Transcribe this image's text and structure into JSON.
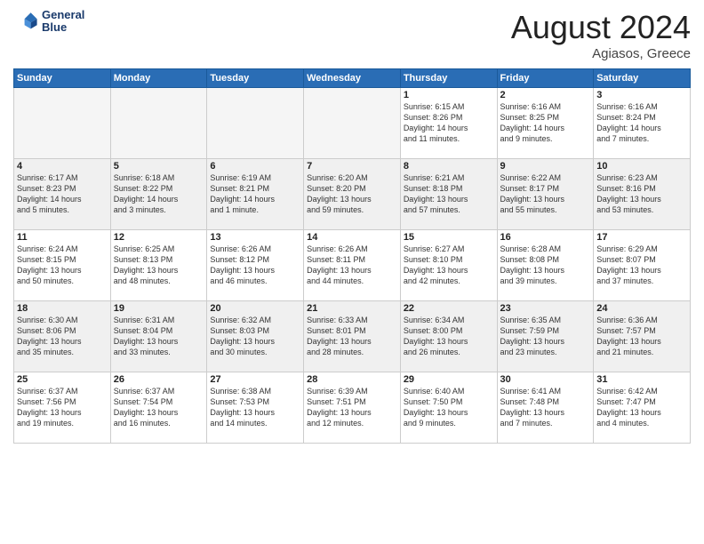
{
  "header": {
    "logo_line1": "General",
    "logo_line2": "Blue",
    "month": "August 2024",
    "location": "Agiasos, Greece"
  },
  "weekdays": [
    "Sunday",
    "Monday",
    "Tuesday",
    "Wednesday",
    "Thursday",
    "Friday",
    "Saturday"
  ],
  "weeks": [
    [
      {
        "day": "",
        "info": "",
        "empty": true
      },
      {
        "day": "",
        "info": "",
        "empty": true
      },
      {
        "day": "",
        "info": "",
        "empty": true
      },
      {
        "day": "",
        "info": "",
        "empty": true
      },
      {
        "day": "1",
        "info": "Sunrise: 6:15 AM\nSunset: 8:26 PM\nDaylight: 14 hours\nand 11 minutes."
      },
      {
        "day": "2",
        "info": "Sunrise: 6:16 AM\nSunset: 8:25 PM\nDaylight: 14 hours\nand 9 minutes."
      },
      {
        "day": "3",
        "info": "Sunrise: 6:16 AM\nSunset: 8:24 PM\nDaylight: 14 hours\nand 7 minutes."
      }
    ],
    [
      {
        "day": "4",
        "info": "Sunrise: 6:17 AM\nSunset: 8:23 PM\nDaylight: 14 hours\nand 5 minutes."
      },
      {
        "day": "5",
        "info": "Sunrise: 6:18 AM\nSunset: 8:22 PM\nDaylight: 14 hours\nand 3 minutes."
      },
      {
        "day": "6",
        "info": "Sunrise: 6:19 AM\nSunset: 8:21 PM\nDaylight: 14 hours\nand 1 minute."
      },
      {
        "day": "7",
        "info": "Sunrise: 6:20 AM\nSunset: 8:20 PM\nDaylight: 13 hours\nand 59 minutes."
      },
      {
        "day": "8",
        "info": "Sunrise: 6:21 AM\nSunset: 8:18 PM\nDaylight: 13 hours\nand 57 minutes."
      },
      {
        "day": "9",
        "info": "Sunrise: 6:22 AM\nSunset: 8:17 PM\nDaylight: 13 hours\nand 55 minutes."
      },
      {
        "day": "10",
        "info": "Sunrise: 6:23 AM\nSunset: 8:16 PM\nDaylight: 13 hours\nand 53 minutes."
      }
    ],
    [
      {
        "day": "11",
        "info": "Sunrise: 6:24 AM\nSunset: 8:15 PM\nDaylight: 13 hours\nand 50 minutes."
      },
      {
        "day": "12",
        "info": "Sunrise: 6:25 AM\nSunset: 8:13 PM\nDaylight: 13 hours\nand 48 minutes."
      },
      {
        "day": "13",
        "info": "Sunrise: 6:26 AM\nSunset: 8:12 PM\nDaylight: 13 hours\nand 46 minutes."
      },
      {
        "day": "14",
        "info": "Sunrise: 6:26 AM\nSunset: 8:11 PM\nDaylight: 13 hours\nand 44 minutes."
      },
      {
        "day": "15",
        "info": "Sunrise: 6:27 AM\nSunset: 8:10 PM\nDaylight: 13 hours\nand 42 minutes."
      },
      {
        "day": "16",
        "info": "Sunrise: 6:28 AM\nSunset: 8:08 PM\nDaylight: 13 hours\nand 39 minutes."
      },
      {
        "day": "17",
        "info": "Sunrise: 6:29 AM\nSunset: 8:07 PM\nDaylight: 13 hours\nand 37 minutes."
      }
    ],
    [
      {
        "day": "18",
        "info": "Sunrise: 6:30 AM\nSunset: 8:06 PM\nDaylight: 13 hours\nand 35 minutes."
      },
      {
        "day": "19",
        "info": "Sunrise: 6:31 AM\nSunset: 8:04 PM\nDaylight: 13 hours\nand 33 minutes."
      },
      {
        "day": "20",
        "info": "Sunrise: 6:32 AM\nSunset: 8:03 PM\nDaylight: 13 hours\nand 30 minutes."
      },
      {
        "day": "21",
        "info": "Sunrise: 6:33 AM\nSunset: 8:01 PM\nDaylight: 13 hours\nand 28 minutes."
      },
      {
        "day": "22",
        "info": "Sunrise: 6:34 AM\nSunset: 8:00 PM\nDaylight: 13 hours\nand 26 minutes."
      },
      {
        "day": "23",
        "info": "Sunrise: 6:35 AM\nSunset: 7:59 PM\nDaylight: 13 hours\nand 23 minutes."
      },
      {
        "day": "24",
        "info": "Sunrise: 6:36 AM\nSunset: 7:57 PM\nDaylight: 13 hours\nand 21 minutes."
      }
    ],
    [
      {
        "day": "25",
        "info": "Sunrise: 6:37 AM\nSunset: 7:56 PM\nDaylight: 13 hours\nand 19 minutes."
      },
      {
        "day": "26",
        "info": "Sunrise: 6:37 AM\nSunset: 7:54 PM\nDaylight: 13 hours\nand 16 minutes."
      },
      {
        "day": "27",
        "info": "Sunrise: 6:38 AM\nSunset: 7:53 PM\nDaylight: 13 hours\nand 14 minutes."
      },
      {
        "day": "28",
        "info": "Sunrise: 6:39 AM\nSunset: 7:51 PM\nDaylight: 13 hours\nand 12 minutes."
      },
      {
        "day": "29",
        "info": "Sunrise: 6:40 AM\nSunset: 7:50 PM\nDaylight: 13 hours\nand 9 minutes."
      },
      {
        "day": "30",
        "info": "Sunrise: 6:41 AM\nSunset: 7:48 PM\nDaylight: 13 hours\nand 7 minutes."
      },
      {
        "day": "31",
        "info": "Sunrise: 6:42 AM\nSunset: 7:47 PM\nDaylight: 13 hours\nand 4 minutes."
      }
    ]
  ],
  "gray_rows": [
    1,
    3
  ]
}
